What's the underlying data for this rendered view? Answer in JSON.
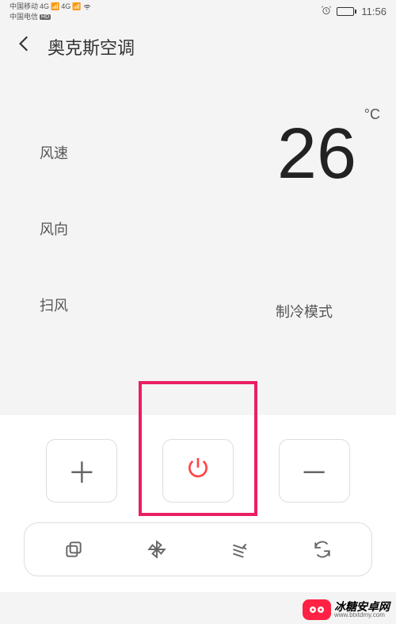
{
  "status": {
    "carrier1": "中国移动",
    "carrier2": "中国电信",
    "hd_label": "HD",
    "signal1": "4G",
    "signal2": "4G",
    "time": "11:56"
  },
  "header": {
    "title": "奥克斯空调"
  },
  "controls": {
    "fan_speed": "风速",
    "fan_direction": "风向",
    "sweep": "扫风"
  },
  "display": {
    "temperature": "26",
    "unit": "°C",
    "mode": "制冷模式"
  },
  "buttons": {
    "plus": "＋",
    "minus": "－"
  },
  "watermark": {
    "brand": "冰糖安卓网",
    "url": "www.btxtdmy.com"
  }
}
